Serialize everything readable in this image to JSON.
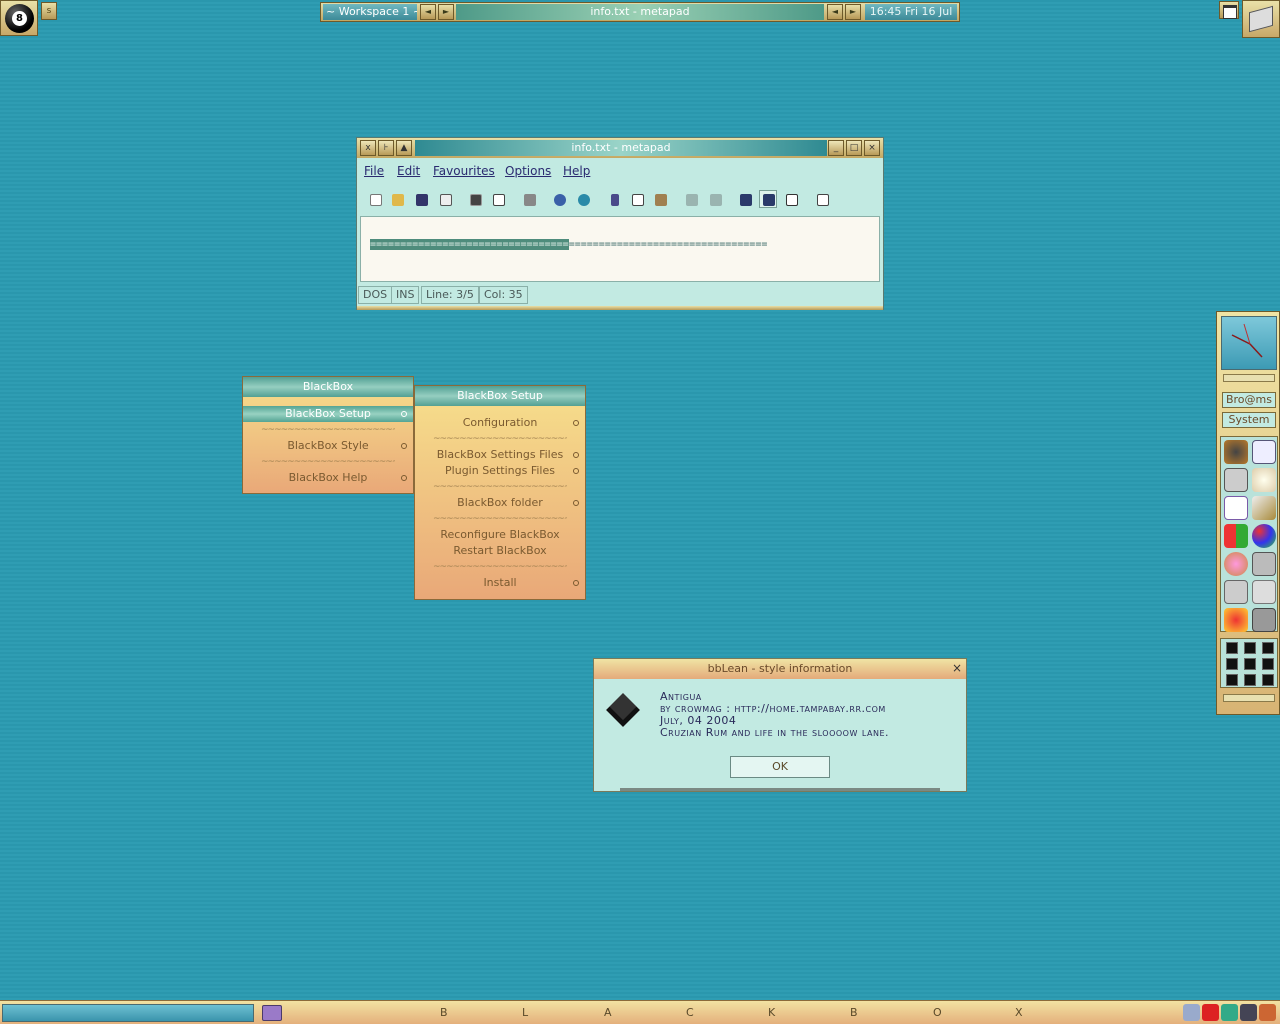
{
  "topbar": {
    "workspace": "~ Workspace 1 ~",
    "title": "info.txt - metapad",
    "clock": "16:45 Fri 16 Jul",
    "arrow_left": "◄",
    "arrow_right": "►"
  },
  "corner_badge_number": "8",
  "window": {
    "title": "info.txt - metapad",
    "menus": [
      "File",
      "Edit",
      "Favourites",
      "Options",
      "Help"
    ],
    "text_selected": "=================================",
    "text_rest": "=================================",
    "status": [
      "DOS",
      "INS",
      "Line: 3/5",
      "Col: 35"
    ]
  },
  "bb_menu": {
    "title": "BlackBox",
    "items": [
      "BlackBox Setup",
      "BlackBox Style",
      "BlackBox Help"
    ],
    "separator": "~~~~~~~~~~~~~~~~~~~~~~~~~~~~~~~~~~~~"
  },
  "bb_setup_menu": {
    "title": "BlackBox Setup",
    "items": [
      "Configuration",
      "BlackBox Settings Files",
      "Plugin Settings Files",
      "BlackBox folder",
      "Reconfigure BlackBox",
      "Restart BlackBox",
      "Install"
    ]
  },
  "dialog": {
    "title": "bbLean - style information",
    "close": "×",
    "lines": [
      "Antigua",
      "by crowmag : http://home.tampabay.rr.com",
      "July, 04 2004",
      "Cruzian Rum and life in the sloooow lane."
    ],
    "ok": "OK"
  },
  "dock": {
    "buttons": [
      "Bro@ms",
      "System"
    ]
  },
  "taskbar": {
    "letters": [
      "B",
      "L",
      "A",
      "C",
      "K",
      "B",
      "O",
      "X"
    ]
  },
  "colors": {
    "desktop": "#2a97ad",
    "accent_teal": "#52a094",
    "menu_gold": "#f7e08c",
    "menu_peach": "#e9a878",
    "window_bg": "#c2eae2"
  }
}
